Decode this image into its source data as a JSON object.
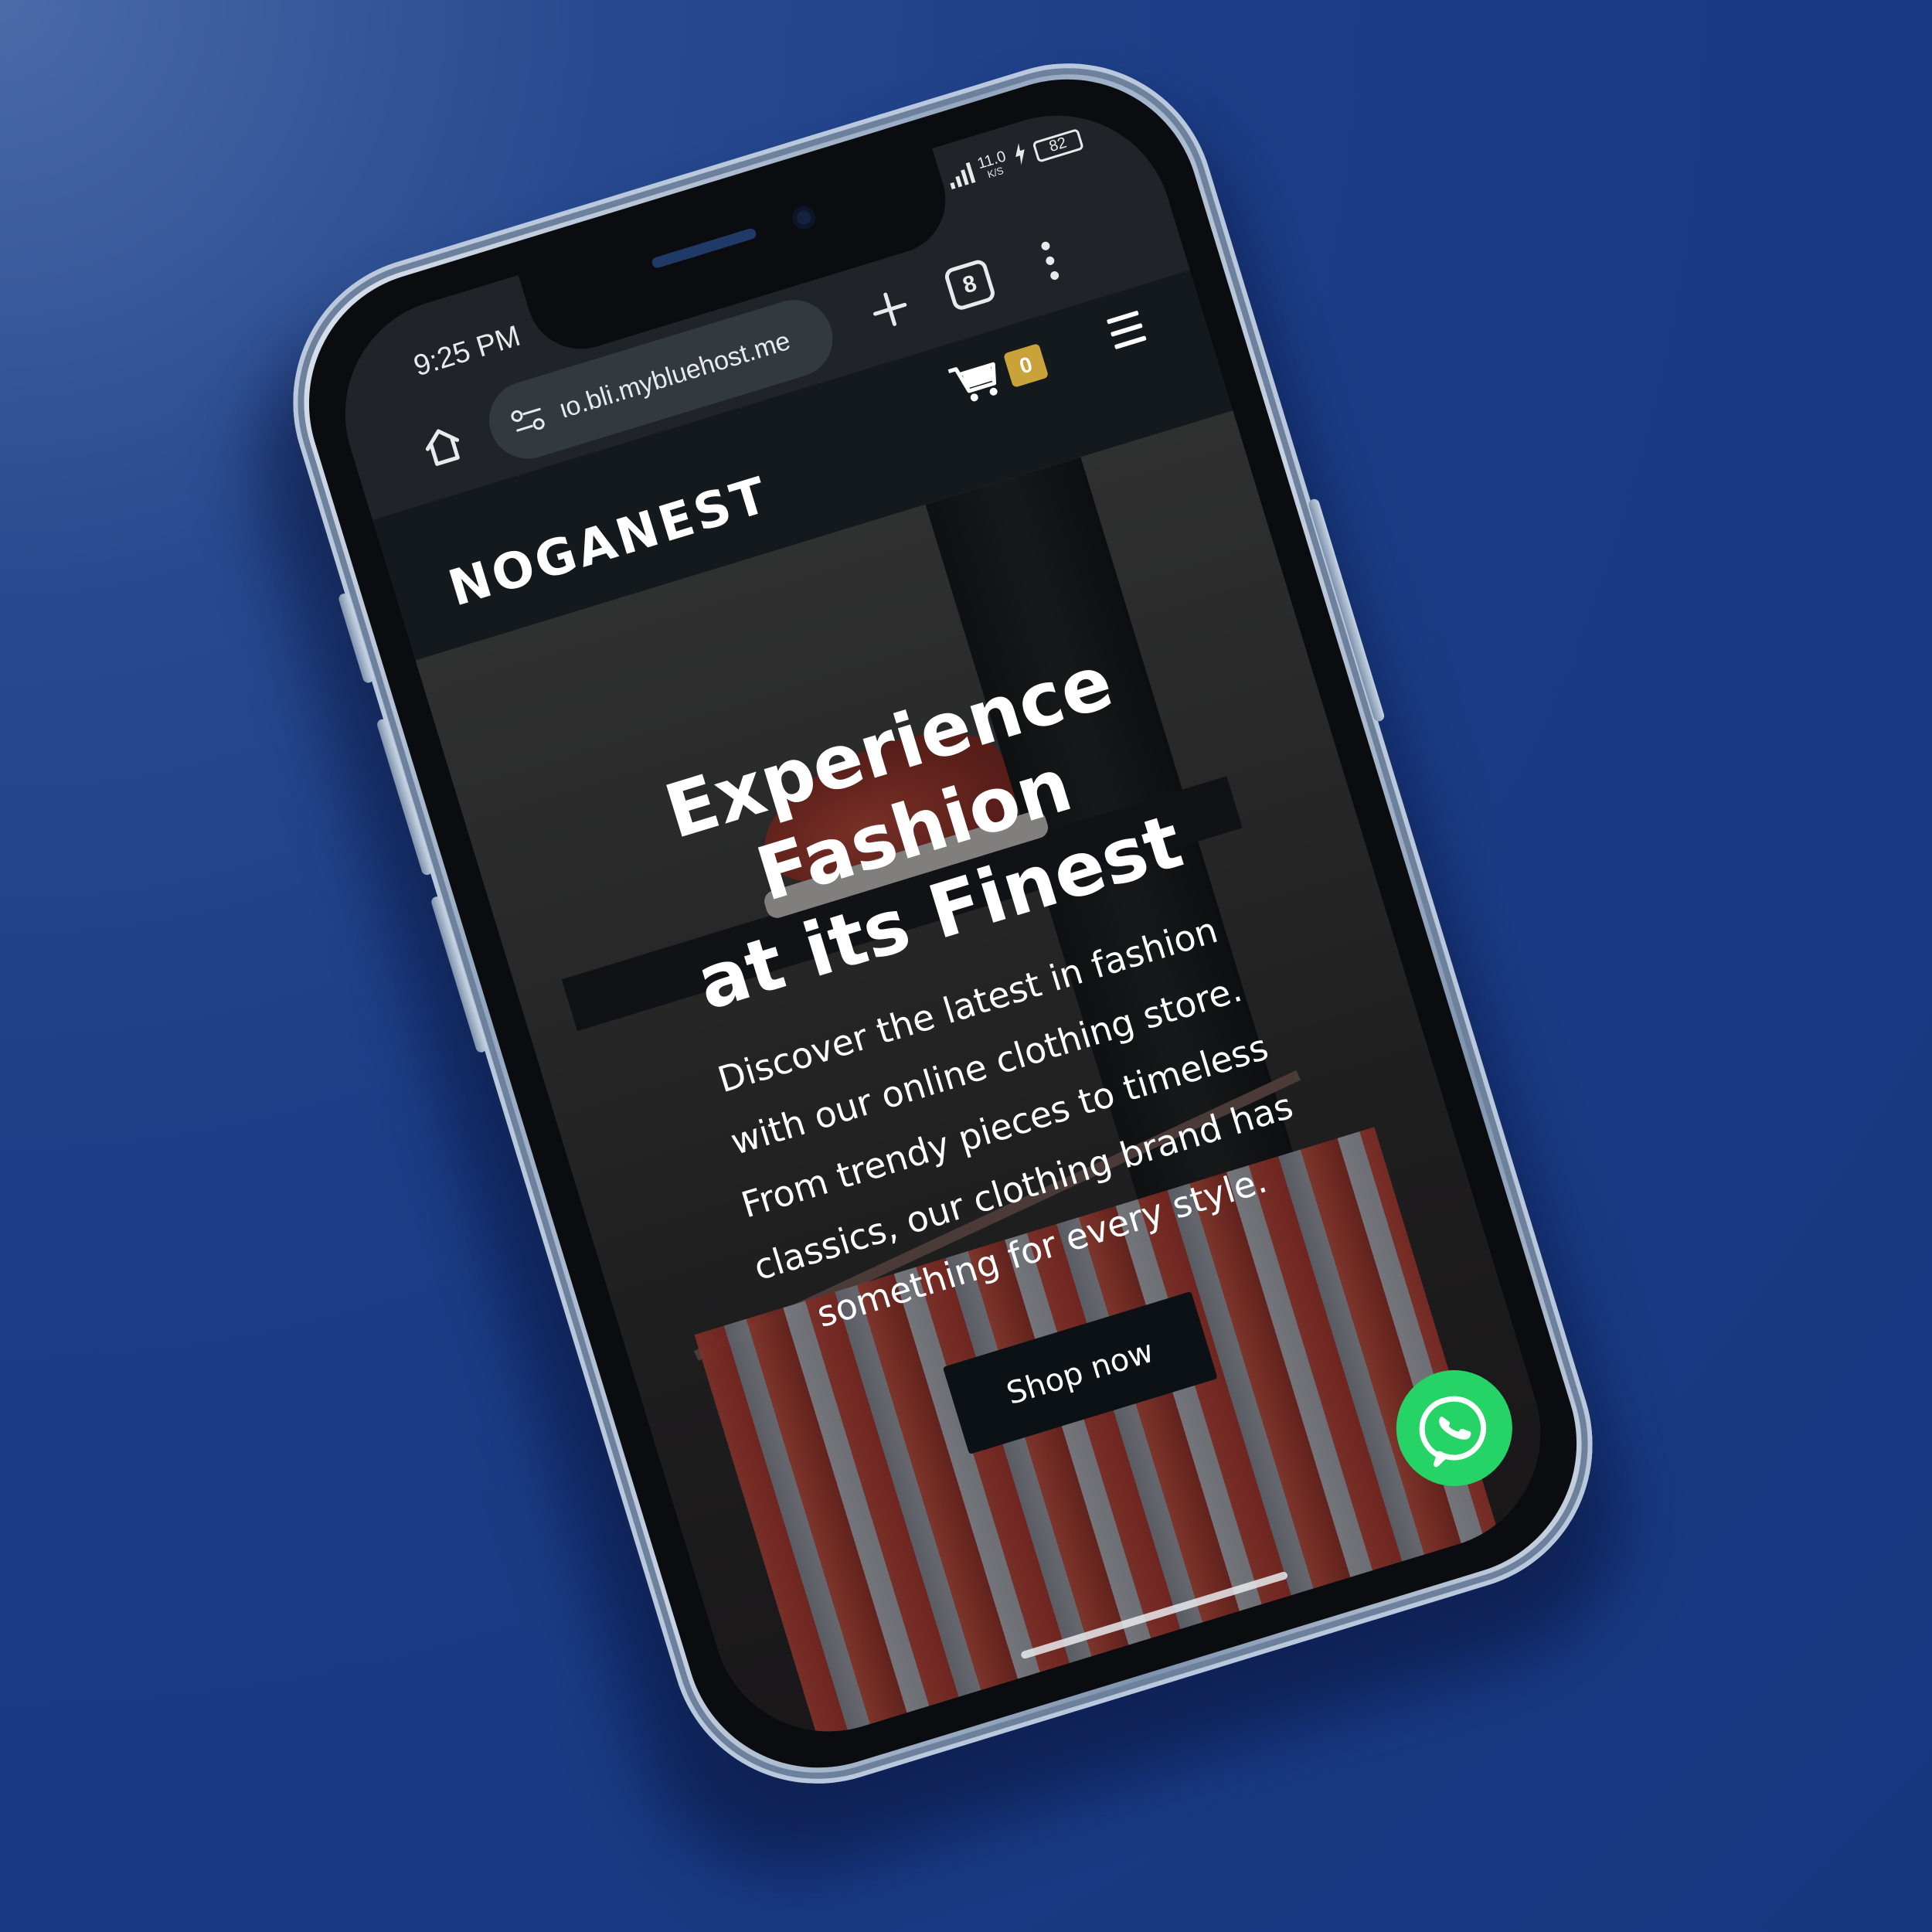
{
  "status_bar": {
    "time": "9:25 PM",
    "net_speed": "11.0",
    "net_speed_unit": "K/S",
    "battery": "82"
  },
  "browser": {
    "url": "ιo.bli.mybluehost.me",
    "tab_count": "8"
  },
  "site": {
    "logo": "NOGANEST",
    "cart_count": "0"
  },
  "hero": {
    "title_line1": "Experience",
    "title_line2": "Fashion",
    "title_line3": "at its Finest",
    "text": "Discover the latest in fashion with our online clothing store. From trendy pieces to timeless classics, our clothing brand has something for every style.",
    "button": "Shop now"
  },
  "colors": {
    "background": "#163680",
    "cart_badge": "#c9a23a",
    "whatsapp": "#25d366",
    "site_header": "#14191d"
  },
  "icons": [
    "home-icon",
    "site-settings-icon",
    "plus-icon",
    "tabs-icon",
    "more-vert-icon",
    "cart-icon",
    "hamburger-icon",
    "whatsapp-icon",
    "signal-icon",
    "charging-icon"
  ]
}
